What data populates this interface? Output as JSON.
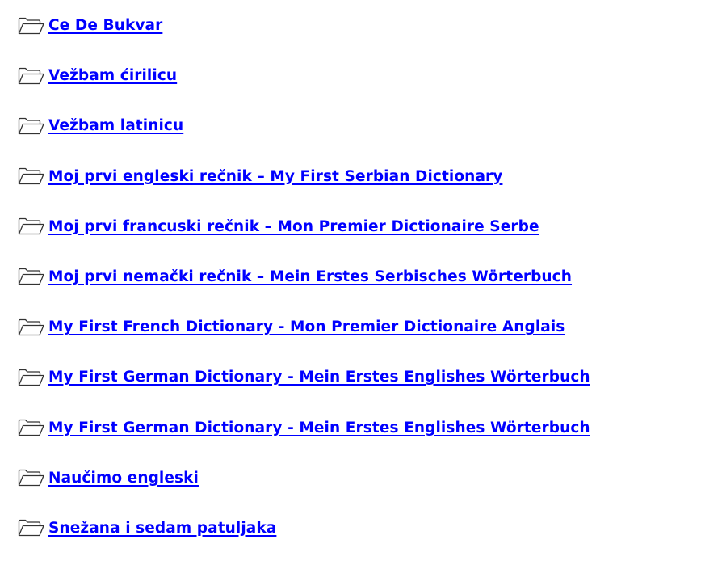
{
  "folders": [
    {
      "label": "Ce De Bukvar",
      "icon": "folder-icon"
    },
    {
      "label": "Vežbam ćirilicu",
      "icon": "folder-icon"
    },
    {
      "label": "Vežbam latinicu",
      "icon": "folder-icon"
    },
    {
      "label": "Moj prvi engleski rečnik – My First Serbian Dictionary",
      "icon": "folder-icon"
    },
    {
      "label": "Moj prvi francuski rečnik – Mon Premier Dictionaire Serbe",
      "icon": "folder-icon"
    },
    {
      "label": "Moj prvi nemački rečnik – Mein Erstes Serbisches Wörterbuch",
      "icon": "folder-icon"
    },
    {
      "label": "My First French Dictionary - Mon Premier Dictionaire Anglais",
      "icon": "folder-icon"
    },
    {
      "label": "My First German Dictionary - Mein Erstes Englishes Wörterbuch",
      "icon": "folder-icon"
    },
    {
      "label": "My First German Dictionary - Mein Erstes Englishes Wörterbuch",
      "icon": "folder-icon"
    },
    {
      "label": "Naučimo engleski",
      "icon": "folder-icon"
    },
    {
      "label": "Snežana i sedam patuljaka",
      "icon": "folder-icon"
    }
  ],
  "colors": {
    "link": "#0000ff",
    "icon_stroke": "#333333",
    "background": "#ffffff"
  }
}
